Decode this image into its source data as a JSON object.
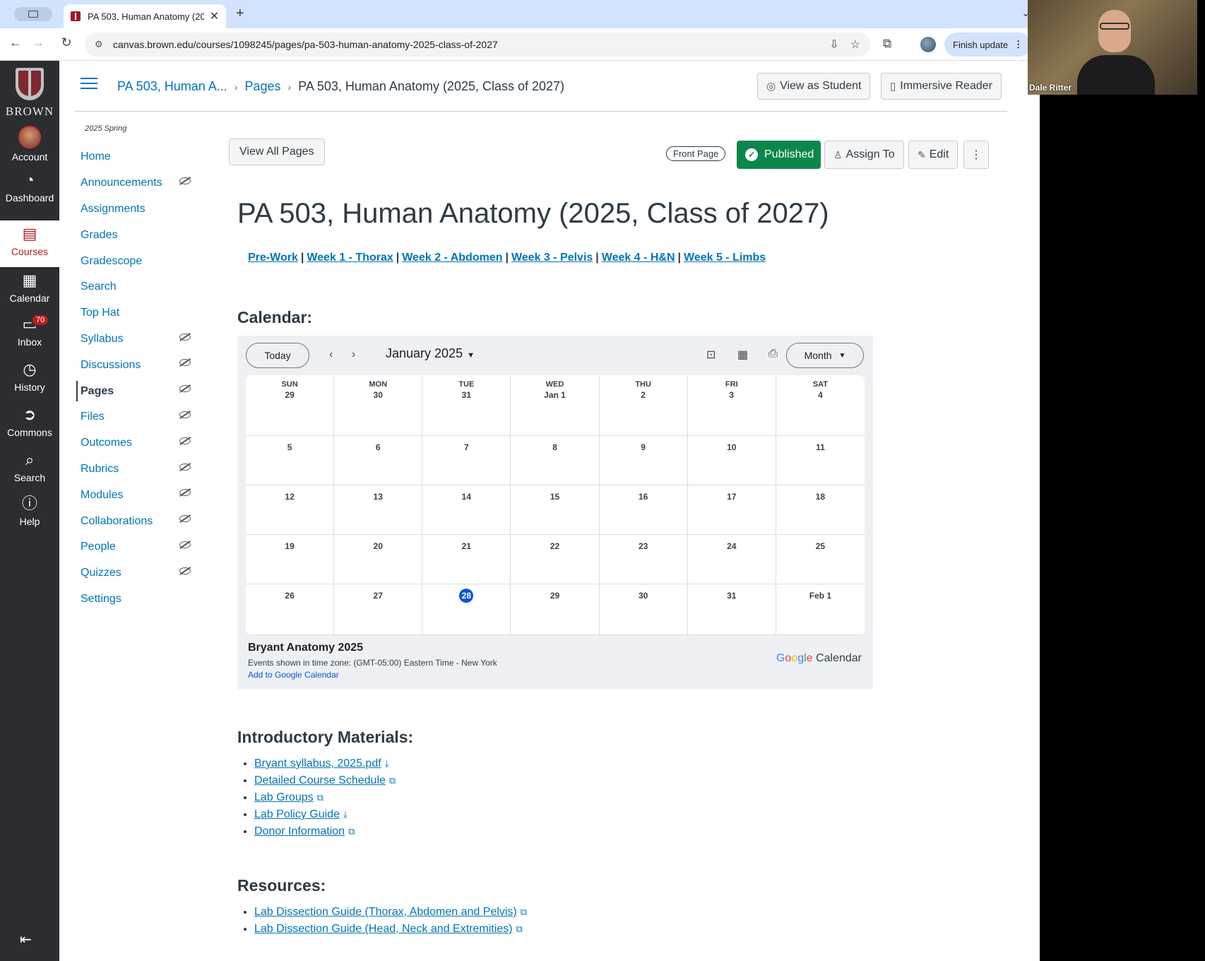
{
  "browser": {
    "tab_title": "PA 503, Human Anatomy (20",
    "tab_close": "✕",
    "new_tab": "+",
    "url": "canvas.brown.edu/courses/1098245/pages/pa-503-human-anatomy-2025-class-of-2027",
    "finish_update_label": "Finish update"
  },
  "global_nav": {
    "logo_text": "BROWN",
    "items": [
      {
        "label": "Account",
        "icon": "account-avatar"
      },
      {
        "label": "Dashboard",
        "icon": "dashboard-icon"
      },
      {
        "label": "Courses",
        "icon": "courses-icon"
      },
      {
        "label": "Calendar",
        "icon": "calendar-icon"
      },
      {
        "label": "Inbox",
        "icon": "inbox-icon",
        "badge": "70"
      },
      {
        "label": "History",
        "icon": "history-icon"
      },
      {
        "label": "Commons",
        "icon": "commons-icon"
      },
      {
        "label": "Search",
        "icon": "search-icon"
      },
      {
        "label": "Help",
        "icon": "help-icon"
      }
    ],
    "active": "Courses"
  },
  "header": {
    "breadcrumb": [
      "PA 503, Human A...",
      "Pages",
      "PA 503, Human Anatomy (2025, Class of 2027)"
    ],
    "view_as_student": "View as Student",
    "immersive_reader": "Immersive Reader"
  },
  "course_nav": {
    "term": "2025 Spring",
    "items": [
      {
        "label": "Home",
        "hidden": false
      },
      {
        "label": "Announcements",
        "hidden": true
      },
      {
        "label": "Assignments",
        "hidden": false
      },
      {
        "label": "Grades",
        "hidden": false
      },
      {
        "label": "Gradescope",
        "hidden": false
      },
      {
        "label": "Search",
        "hidden": false
      },
      {
        "label": "Top Hat",
        "hidden": false
      },
      {
        "label": "Syllabus",
        "hidden": true
      },
      {
        "label": "Discussions",
        "hidden": true
      },
      {
        "label": "Pages",
        "hidden": true,
        "active": true
      },
      {
        "label": "Files",
        "hidden": true
      },
      {
        "label": "Outcomes",
        "hidden": true
      },
      {
        "label": "Rubrics",
        "hidden": true
      },
      {
        "label": "Modules",
        "hidden": true
      },
      {
        "label": "Collaborations",
        "hidden": true
      },
      {
        "label": "People",
        "hidden": true
      },
      {
        "label": "Quizzes",
        "hidden": true
      },
      {
        "label": "Settings",
        "hidden": false
      }
    ]
  },
  "page": {
    "view_all_pages": "View All Pages",
    "front_page_badge": "Front Page",
    "published_label": "Published",
    "assign_to_label": "Assign To",
    "edit_label": "Edit",
    "more_label": "⋮",
    "title": "PA 503, Human Anatomy (2025, Class of 2027)",
    "week_links": [
      "Pre-Work",
      "Week 1 - Thorax",
      "Week 2 - Abdomen",
      "Week 3 - Pelvis",
      "Week 4 - H&N",
      "Week 5 - Limbs"
    ],
    "calendar_heading": "Calendar:",
    "intro_heading": "Introductory Materials:",
    "intro_links": [
      {
        "label": "Bryant syllabus, 2025.pdf",
        "icon": "download-icon"
      },
      {
        "label": "Detailed Course Schedule",
        "icon": "external-page-icon"
      },
      {
        "label": "Lab Groups",
        "icon": "external-page-icon"
      },
      {
        "label": "Lab Policy Guide",
        "icon": "download-icon"
      },
      {
        "label": "Donor Information",
        "icon": "external-page-icon"
      }
    ],
    "resources_heading": "Resources:",
    "resource_links": [
      {
        "label": "Lab Dissection Guide (Thorax, Abdomen and Pelvis)",
        "icon": "external-page-icon"
      },
      {
        "label": "Lab Dissection Guide (Head, Neck and Extremities)",
        "icon": "external-page-icon"
      }
    ]
  },
  "gcal": {
    "today_label": "Today",
    "month_label": "January 2025",
    "view_label": "Month",
    "weekdays": [
      "SUN",
      "MON",
      "TUE",
      "WED",
      "THU",
      "FRI",
      "SAT"
    ],
    "weeks": [
      [
        "29",
        "30",
        "31",
        "Jan 1",
        "2",
        "3",
        "4"
      ],
      [
        "5",
        "6",
        "7",
        "8",
        "9",
        "10",
        "11"
      ],
      [
        "12",
        "13",
        "14",
        "15",
        "16",
        "17",
        "18"
      ],
      [
        "19",
        "20",
        "21",
        "22",
        "23",
        "24",
        "25"
      ],
      [
        "26",
        "27",
        "28",
        "29",
        "30",
        "31",
        "Feb 1"
      ]
    ],
    "today_date": "28",
    "calendar_name": "Bryant Anatomy 2025",
    "timezone_note": "Events shown in time zone: (GMT-05:00) Eastern Time - New York",
    "add_link": "Add to Google Calendar",
    "brand_suffix": "Calendar",
    "accent": "#0b57d0"
  },
  "webcam": {
    "name": "Dale Ritter"
  },
  "colors": {
    "link": "#0374b5",
    "published": "#0b874b",
    "global_nav_bg": "#2b2d30",
    "active_red": "#b71c1c"
  }
}
